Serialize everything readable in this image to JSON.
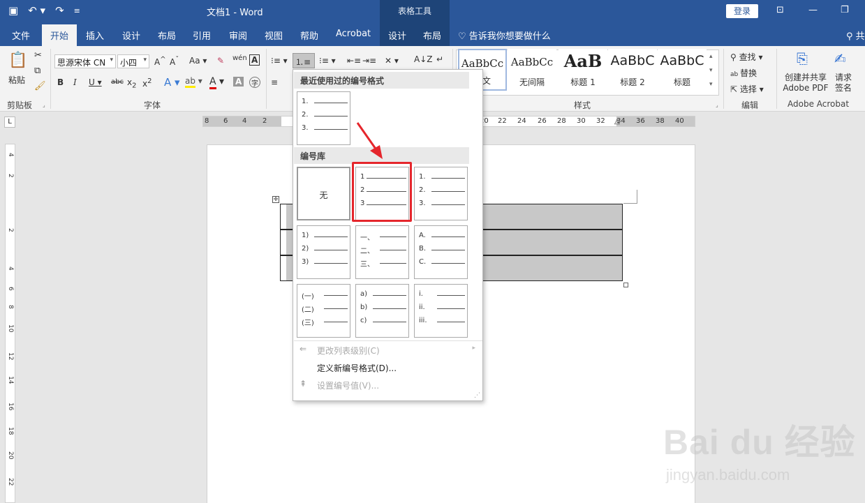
{
  "titlebar": {
    "doc_title": "文档1  -  Word",
    "context_tab": "表格工具",
    "login_label": "登录",
    "qat_icons": [
      "save-icon",
      "undo-icon",
      "redo-icon",
      "customize-icon"
    ]
  },
  "tabs": {
    "file": "文件",
    "home": "开始",
    "insert": "插入",
    "design": "设计",
    "layout": "布局",
    "references": "引用",
    "review": "审阅",
    "view": "视图",
    "help": "帮助",
    "acrobat": "Acrobat",
    "table_design": "设计",
    "table_layout": "布局",
    "tell_me": "告诉我你想要做什么"
  },
  "ribbon": {
    "paste_label": "粘贴",
    "clipboard_label": "剪贴板",
    "font_label": "字体",
    "font_name": "思源宋体 CN",
    "font_size": "小四",
    "styles_label": "样式",
    "edit_label": "编辑",
    "find_label": "查找",
    "replace_label": "替换",
    "select_label": "选择",
    "create_pdf_label": "创建并共享 Adobe PDF",
    "request_sign_label": "请求签名",
    "acrobat_group_label": "Adobe Acrobat",
    "styles": [
      {
        "preview": "AaBbCc",
        "name": "正文"
      },
      {
        "preview": "AaBbCc",
        "name": "无间隔"
      },
      {
        "preview": "AaB",
        "name": "标题 1"
      },
      {
        "preview": "AaBbC",
        "name": "标题 2"
      },
      {
        "preview": "AaBbC",
        "name": "标题"
      }
    ]
  },
  "ruler": {
    "left_numbers": [
      "8",
      "6",
      "4",
      "2"
    ],
    "right_numbers": [
      "20",
      "22",
      "24",
      "26",
      "28",
      "30",
      "32",
      "34",
      "36",
      "38",
      "40"
    ],
    "vertical_numbers": [
      "4",
      "2",
      "2",
      "4",
      "6",
      "8",
      "10",
      "12",
      "14",
      "16",
      "18",
      "20",
      "22"
    ]
  },
  "dropdown": {
    "recent_header": "最近使用过的编号格式",
    "library_header": "编号库",
    "none_label": "无",
    "recent": [
      {
        "labels": [
          "1.",
          "2.",
          "3."
        ]
      }
    ],
    "library": [
      {
        "labels": [
          "1",
          "2",
          "3"
        ],
        "highlighted": true
      },
      {
        "labels": [
          "1.",
          "2.",
          "3."
        ]
      },
      {
        "labels": [
          "1)",
          "2)",
          "3)"
        ]
      },
      {
        "labels": [
          "一、",
          "二、",
          "三、"
        ]
      },
      {
        "labels": [
          "A.",
          "B.",
          "C."
        ]
      },
      {
        "labels": [
          "(一)",
          "(二)",
          "(三)"
        ]
      },
      {
        "labels": [
          "a)",
          "b)",
          "c)"
        ]
      },
      {
        "labels": [
          "i.",
          "ii.",
          "iii."
        ]
      }
    ],
    "menu": {
      "change_level": "更改列表级别(C)",
      "define_new": "定义新编号格式(D)...",
      "set_value": "设置编号值(V)..."
    }
  },
  "watermark": {
    "brand": "Bai du 经验",
    "url": "jingyan.baidu.com"
  },
  "colors": {
    "title_blue": "#2b579a",
    "highlight_red": "#e5262c",
    "ribbon_bg": "#f3f3f3"
  }
}
